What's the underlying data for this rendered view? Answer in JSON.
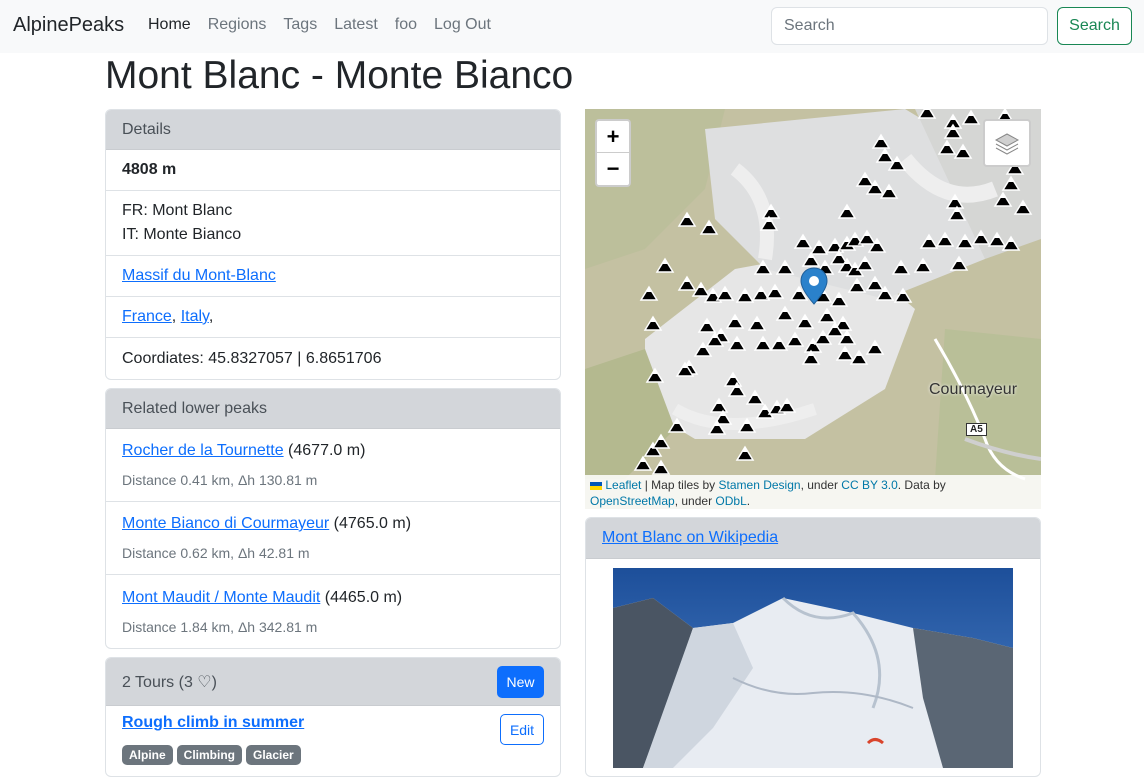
{
  "navbar": {
    "brand": "AlpinePeaks",
    "links": [
      "Home",
      "Regions",
      "Tags",
      "Latest",
      "foo",
      "Log Out"
    ],
    "search_placeholder": "Search",
    "search_button": "Search"
  },
  "page": {
    "title": "Mont Blanc - Monte Bianco"
  },
  "details": {
    "header": "Details",
    "elevation": "4808 m",
    "name_fr": "FR: Mont Blanc",
    "name_it": "IT: Monte Bianco",
    "massif": "Massif du Mont-Blanc",
    "country_1": "France",
    "country_sep": ",",
    "country_2": "Italy",
    "country_trail": ",",
    "coordinates": "Coordiates: 45.8327057 | 6.8651706"
  },
  "related": {
    "header": "Related lower peaks",
    "peaks": [
      {
        "name": "Rocher de la Tournette",
        "elevation": "(4677.0 m)",
        "distance": "Distance 0.41 km, Δh 130.81 m"
      },
      {
        "name": "Monte Bianco di Courmayeur",
        "elevation": "(4765.0 m)",
        "distance": "Distance 0.62 km, Δh 42.81 m"
      },
      {
        "name": "Mont Maudit / Monte Maudit",
        "elevation": "(4465.0 m)",
        "distance": "Distance 1.84 km, Δh 342.81 m"
      }
    ]
  },
  "tours": {
    "header": "2 Tours (3 ♡)",
    "new_button": "New",
    "items": [
      {
        "title": "Rough climb in summer",
        "edit_button": "Edit",
        "tags": [
          "Alpine",
          "Climbing",
          "Glacier"
        ]
      }
    ]
  },
  "map": {
    "zoom_in": "+",
    "zoom_out": "−",
    "town_label": "Courmayeur",
    "road_label": "A5",
    "attribution": {
      "leaflet": "Leaflet",
      "text1": " | Map tiles by ",
      "stamen": "Stamen Design",
      "text2": ", under ",
      "ccby": "CC BY 3.0",
      "text3": ". Data by ",
      "osm": "OpenStreetMap",
      "text4": ", under ",
      "odbl": "ODbL",
      "text5": "."
    }
  },
  "wiki": {
    "header": "Mont Blanc on Wikipedia"
  },
  "colors": {
    "primary": "#0d6efd",
    "success": "#198754",
    "header_bg": "#d3d6da",
    "muted": "#6c757d"
  }
}
